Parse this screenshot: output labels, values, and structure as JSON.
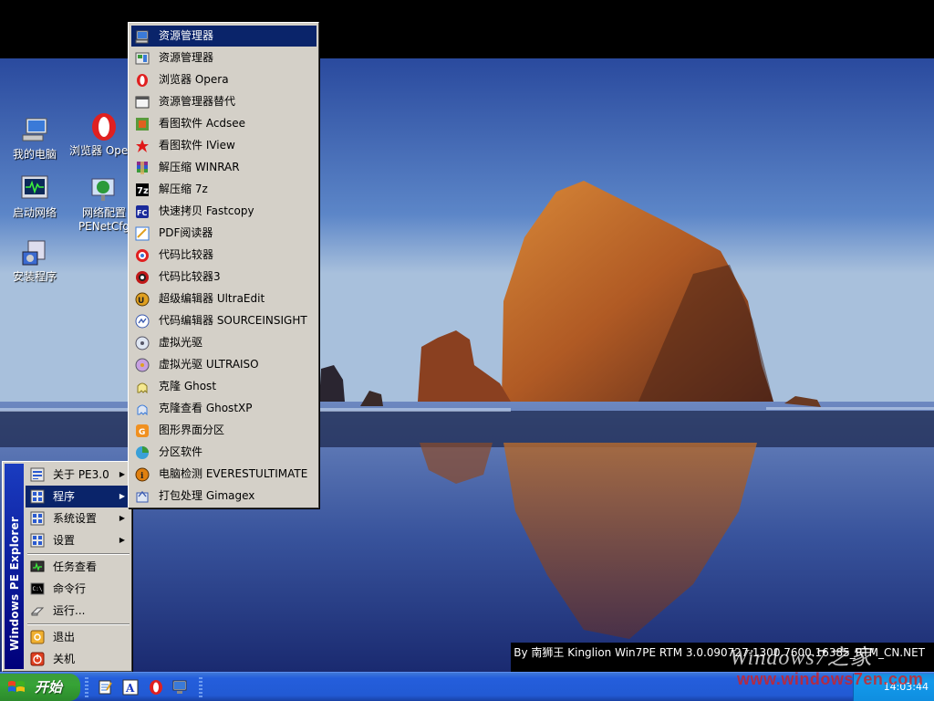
{
  "desktop": {
    "icons": [
      {
        "label": "我的电脑",
        "icon": "my-computer-icon"
      },
      {
        "label": "浏览器 Opera",
        "icon": "opera-icon"
      },
      {
        "label": "启动网络",
        "icon": "network-start-icon"
      },
      {
        "label": "网络配置",
        "sub": "PENetCfg",
        "icon": "network-config-icon"
      },
      {
        "label": "安装程序",
        "icon": "installer-icon"
      }
    ],
    "info_text": "By 南狮王 Kinglion Win7PE RTM 3.0.090727-1300.7600.16385_RTM_CN.NET"
  },
  "start_menu": {
    "banner": "Windows PE Explorer",
    "items": [
      {
        "label": "关于 PE3.0",
        "icon": "about-icon",
        "submenu": true
      },
      {
        "label": "程序",
        "icon": "programs-icon",
        "submenu": true,
        "highlighted": true
      },
      {
        "label": "系统设置",
        "icon": "system-settings-icon",
        "submenu": true
      },
      {
        "label": "设置",
        "icon": "settings-icon",
        "submenu": true
      },
      {
        "label": "任务查看",
        "icon": "task-view-icon"
      },
      {
        "label": "命令行",
        "icon": "command-line-icon"
      },
      {
        "label": "运行...",
        "icon": "run-icon"
      },
      {
        "label": "退出",
        "icon": "logoff-icon"
      },
      {
        "label": "关机",
        "icon": "shutdown-icon"
      }
    ],
    "arrow_glyph": "▶"
  },
  "programs_menu": {
    "items": [
      {
        "label": "资源管理器",
        "icon": "explorer-icon",
        "highlighted": true
      },
      {
        "label": "资源管理器",
        "icon": "explorer-alt-icon"
      },
      {
        "label": "浏览器 Opera",
        "icon": "opera-icon"
      },
      {
        "label": "资源管理器替代",
        "icon": "explorer-replacement-icon"
      },
      {
        "label": "看图软件 Acdsee",
        "icon": "acdsee-icon"
      },
      {
        "label": "看图软件 IView",
        "icon": "irfanview-icon"
      },
      {
        "label": "解压缩 WINRAR",
        "icon": "winrar-icon"
      },
      {
        "label": "解压缩 7z",
        "icon": "7zip-icon"
      },
      {
        "label": "快速拷贝 Fastcopy",
        "icon": "fastcopy-icon"
      },
      {
        "label": "PDF阅读器",
        "icon": "pdf-reader-icon"
      },
      {
        "label": "代码比较器",
        "icon": "code-compare-icon"
      },
      {
        "label": "代码比较器3",
        "icon": "code-compare3-icon"
      },
      {
        "label": "超级编辑器 UltraEdit",
        "icon": "ultraedit-icon"
      },
      {
        "label": "代码编辑器 SOURCEINSIGHT",
        "icon": "sourceinsight-icon"
      },
      {
        "label": "虚拟光驱",
        "icon": "virtual-drive-icon"
      },
      {
        "label": "虚拟光驱 ULTRAISO",
        "icon": "ultraiso-icon"
      },
      {
        "label": "克隆 Ghost",
        "icon": "ghost-icon"
      },
      {
        "label": "克隆查看 GhostXP",
        "icon": "ghostxp-icon"
      },
      {
        "label": "图形界面分区",
        "icon": "partition-gui-icon"
      },
      {
        "label": "分区软件",
        "icon": "partition-icon"
      },
      {
        "label": "电脑检测 EVERESTULTIMATE",
        "icon": "everest-icon"
      },
      {
        "label": "打包处理 Gimagex",
        "icon": "gimagex-icon"
      }
    ]
  },
  "taskbar": {
    "start_label": "开始",
    "quick_launch": [
      "notepad-icon",
      "font-icon",
      "opera-icon",
      "monitor-icon"
    ],
    "clock": "14:03:44"
  },
  "watermark": {
    "title": "Windows7之家",
    "url": "www.windows7en.com"
  },
  "colors": {
    "menu_bg": "#d4d0c8",
    "highlight": "#0a246a",
    "taskbar": "#245edc",
    "start_green": "#36a336"
  }
}
